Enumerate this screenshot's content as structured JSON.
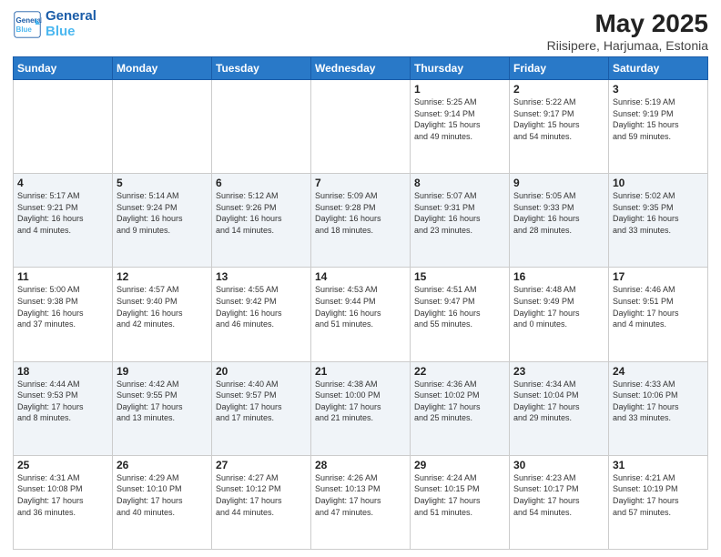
{
  "logo": {
    "line1": "General",
    "line2": "Blue"
  },
  "title": "May 2025",
  "subtitle": "Riisipere, Harjumaa, Estonia",
  "days_of_week": [
    "Sunday",
    "Monday",
    "Tuesday",
    "Wednesday",
    "Thursday",
    "Friday",
    "Saturday"
  ],
  "weeks": [
    [
      {
        "day": "",
        "info": ""
      },
      {
        "day": "",
        "info": ""
      },
      {
        "day": "",
        "info": ""
      },
      {
        "day": "",
        "info": ""
      },
      {
        "day": "1",
        "info": "Sunrise: 5:25 AM\nSunset: 9:14 PM\nDaylight: 15 hours\nand 49 minutes."
      },
      {
        "day": "2",
        "info": "Sunrise: 5:22 AM\nSunset: 9:17 PM\nDaylight: 15 hours\nand 54 minutes."
      },
      {
        "day": "3",
        "info": "Sunrise: 5:19 AM\nSunset: 9:19 PM\nDaylight: 15 hours\nand 59 minutes."
      }
    ],
    [
      {
        "day": "4",
        "info": "Sunrise: 5:17 AM\nSunset: 9:21 PM\nDaylight: 16 hours\nand 4 minutes."
      },
      {
        "day": "5",
        "info": "Sunrise: 5:14 AM\nSunset: 9:24 PM\nDaylight: 16 hours\nand 9 minutes."
      },
      {
        "day": "6",
        "info": "Sunrise: 5:12 AM\nSunset: 9:26 PM\nDaylight: 16 hours\nand 14 minutes."
      },
      {
        "day": "7",
        "info": "Sunrise: 5:09 AM\nSunset: 9:28 PM\nDaylight: 16 hours\nand 18 minutes."
      },
      {
        "day": "8",
        "info": "Sunrise: 5:07 AM\nSunset: 9:31 PM\nDaylight: 16 hours\nand 23 minutes."
      },
      {
        "day": "9",
        "info": "Sunrise: 5:05 AM\nSunset: 9:33 PM\nDaylight: 16 hours\nand 28 minutes."
      },
      {
        "day": "10",
        "info": "Sunrise: 5:02 AM\nSunset: 9:35 PM\nDaylight: 16 hours\nand 33 minutes."
      }
    ],
    [
      {
        "day": "11",
        "info": "Sunrise: 5:00 AM\nSunset: 9:38 PM\nDaylight: 16 hours\nand 37 minutes."
      },
      {
        "day": "12",
        "info": "Sunrise: 4:57 AM\nSunset: 9:40 PM\nDaylight: 16 hours\nand 42 minutes."
      },
      {
        "day": "13",
        "info": "Sunrise: 4:55 AM\nSunset: 9:42 PM\nDaylight: 16 hours\nand 46 minutes."
      },
      {
        "day": "14",
        "info": "Sunrise: 4:53 AM\nSunset: 9:44 PM\nDaylight: 16 hours\nand 51 minutes."
      },
      {
        "day": "15",
        "info": "Sunrise: 4:51 AM\nSunset: 9:47 PM\nDaylight: 16 hours\nand 55 minutes."
      },
      {
        "day": "16",
        "info": "Sunrise: 4:48 AM\nSunset: 9:49 PM\nDaylight: 17 hours\nand 0 minutes."
      },
      {
        "day": "17",
        "info": "Sunrise: 4:46 AM\nSunset: 9:51 PM\nDaylight: 17 hours\nand 4 minutes."
      }
    ],
    [
      {
        "day": "18",
        "info": "Sunrise: 4:44 AM\nSunset: 9:53 PM\nDaylight: 17 hours\nand 8 minutes."
      },
      {
        "day": "19",
        "info": "Sunrise: 4:42 AM\nSunset: 9:55 PM\nDaylight: 17 hours\nand 13 minutes."
      },
      {
        "day": "20",
        "info": "Sunrise: 4:40 AM\nSunset: 9:57 PM\nDaylight: 17 hours\nand 17 minutes."
      },
      {
        "day": "21",
        "info": "Sunrise: 4:38 AM\nSunset: 10:00 PM\nDaylight: 17 hours\nand 21 minutes."
      },
      {
        "day": "22",
        "info": "Sunrise: 4:36 AM\nSunset: 10:02 PM\nDaylight: 17 hours\nand 25 minutes."
      },
      {
        "day": "23",
        "info": "Sunrise: 4:34 AM\nSunset: 10:04 PM\nDaylight: 17 hours\nand 29 minutes."
      },
      {
        "day": "24",
        "info": "Sunrise: 4:33 AM\nSunset: 10:06 PM\nDaylight: 17 hours\nand 33 minutes."
      }
    ],
    [
      {
        "day": "25",
        "info": "Sunrise: 4:31 AM\nSunset: 10:08 PM\nDaylight: 17 hours\nand 36 minutes."
      },
      {
        "day": "26",
        "info": "Sunrise: 4:29 AM\nSunset: 10:10 PM\nDaylight: 17 hours\nand 40 minutes."
      },
      {
        "day": "27",
        "info": "Sunrise: 4:27 AM\nSunset: 10:12 PM\nDaylight: 17 hours\nand 44 minutes."
      },
      {
        "day": "28",
        "info": "Sunrise: 4:26 AM\nSunset: 10:13 PM\nDaylight: 17 hours\nand 47 minutes."
      },
      {
        "day": "29",
        "info": "Sunrise: 4:24 AM\nSunset: 10:15 PM\nDaylight: 17 hours\nand 51 minutes."
      },
      {
        "day": "30",
        "info": "Sunrise: 4:23 AM\nSunset: 10:17 PM\nDaylight: 17 hours\nand 54 minutes."
      },
      {
        "day": "31",
        "info": "Sunrise: 4:21 AM\nSunset: 10:19 PM\nDaylight: 17 hours\nand 57 minutes."
      }
    ]
  ]
}
